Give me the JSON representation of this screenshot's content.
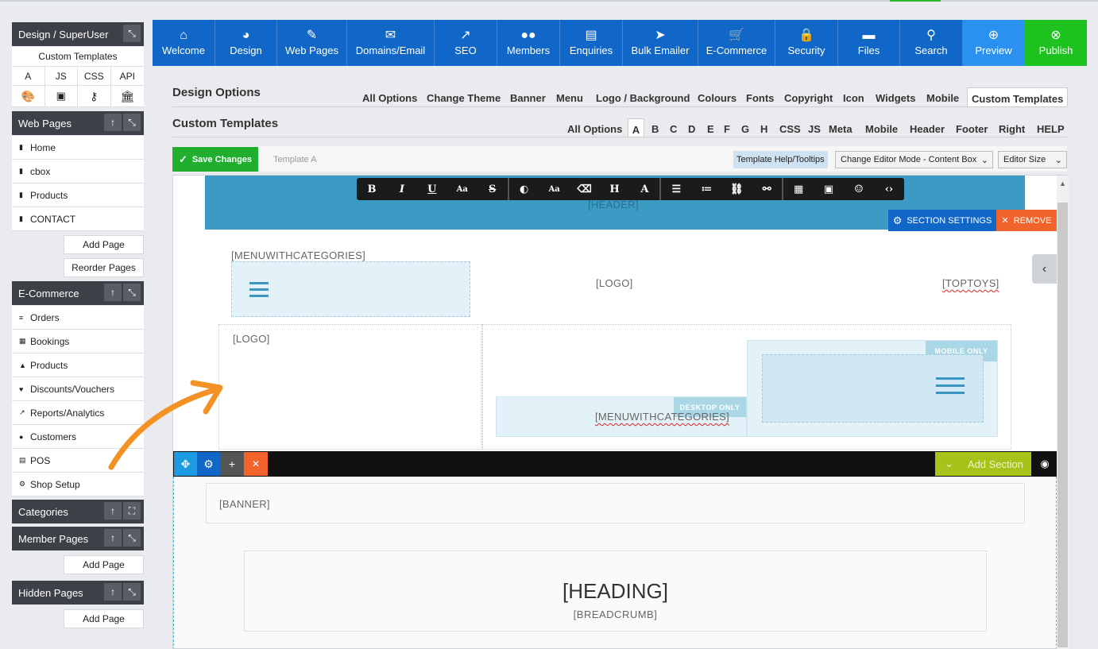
{
  "sidebar": {
    "design_header": "Design / SuperUser",
    "custom_templates": "Custom Templates",
    "code_tabs": [
      "A",
      "JS",
      "CSS",
      "API"
    ],
    "web_pages_header": "Web Pages",
    "web_pages": [
      "Home",
      "cbox",
      "Products",
      "CONTACT"
    ],
    "add_page": "Add Page",
    "reorder_pages": "Reorder Pages",
    "ecommerce_header": "E-Commerce",
    "ecommerce_items": [
      "Orders",
      "Bookings",
      "Products",
      "Discounts/Vouchers",
      "Reports/Analytics",
      "Customers",
      "POS",
      "Shop Setup"
    ],
    "categories_header": "Categories",
    "member_pages_header": "Member Pages",
    "member_add_page": "Add Page",
    "hidden_pages_header": "Hidden Pages",
    "hidden_add_page": "Add Page"
  },
  "topnav": {
    "items": [
      "Welcome",
      "Design",
      "Web Pages",
      "Domains/Email",
      "SEO",
      "Members",
      "Enquiries",
      "Bulk Emailer",
      "E-Commerce",
      "Security",
      "Files",
      "Search",
      "Preview",
      "Publish"
    ],
    "colors": {
      "primary": "#1167c8",
      "preview": "#2a91f0",
      "publish": "#1ec21e"
    }
  },
  "design_options": {
    "title": "Design Options",
    "tabs": [
      "All Options",
      "Change Theme",
      "Banner",
      "Menu",
      "Logo / Background",
      "Colours",
      "Fonts",
      "Copyright",
      "Icon",
      "Widgets",
      "Mobile",
      "Custom Templates"
    ],
    "active_tab": "Custom Templates"
  },
  "custom_templates": {
    "title": "Custom Templates",
    "tabs": [
      "All Options",
      "A",
      "B",
      "C",
      "D",
      "E",
      "F",
      "G",
      "H",
      "CSS",
      "JS",
      "Meta",
      "Mobile",
      "Header",
      "Footer",
      "Right",
      "HELP"
    ],
    "active_tab": "A"
  },
  "toolbar": {
    "save_label": "Save Changes",
    "template_name": "Template A",
    "help_label": "Template Help/Tooltips",
    "editor_mode": "Change Editor Mode - Content Box",
    "editor_size": "Editor Size"
  },
  "editor": {
    "header_tag": "[HEADER]",
    "section_settings": "SECTION SETTINGS",
    "remove": "REMOVE",
    "menu_tag": "[MENUWITHCATEGORIES]",
    "logo_tag": "[LOGO]",
    "toptoys_tag": "[TOPTOYS]",
    "logo_tag2": "[LOGO]",
    "mobile_only": "MOBILE ONLY",
    "desktop_only": "DESKTOP ONLY",
    "menu_tag2": "[MENUWITHCATEGORIES]",
    "add_section": "Add Section",
    "banner_tag": "[BANNER]",
    "heading_tag": "[HEADING]",
    "breadcrumb_tag": "[BREADCRUMB]"
  },
  "format_bar": [
    "B",
    "I",
    "U",
    "Aa",
    "S",
    "◐",
    "Aa",
    "eraser",
    "H",
    "A",
    "align",
    "list",
    "link",
    "unlink",
    "table",
    "image",
    "emoji",
    "code"
  ]
}
